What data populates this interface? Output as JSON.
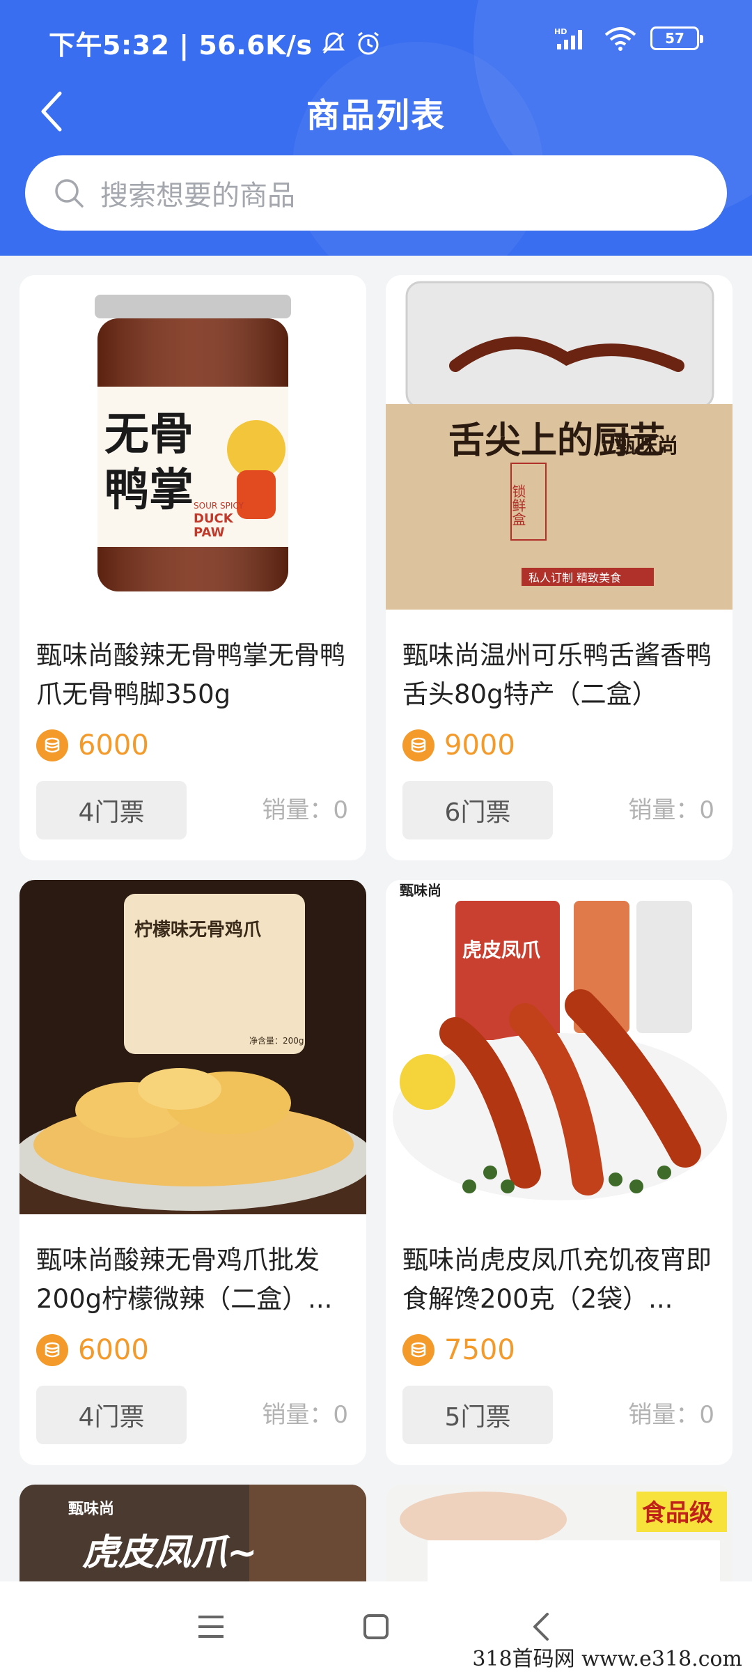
{
  "status_bar": {
    "time_speed": "下午5:32 | 56.6K/s",
    "network": "HD",
    "battery": "57"
  },
  "nav": {
    "title": "商品列表"
  },
  "search": {
    "placeholder": "搜索想要的商品"
  },
  "products": [
    {
      "name": "甄味尚酸辣无骨鸭掌无骨鸭爪无骨鸭脚350g",
      "price": "6000",
      "ticket": "4门票",
      "sales": "销量：0",
      "image_text": [
        "无骨",
        "鸭掌",
        "SOUR SPICY",
        "DUCK",
        "PAW"
      ]
    },
    {
      "name": "甄味尚温州可乐鸭舌酱香鸭舌头80g特产（二盒）",
      "price": "9000",
      "ticket": "6门票",
      "sales": "销量：0",
      "image_text": [
        "舌尖上的厨艺",
        "锁鲜盒",
        "甄味尚",
        "私人订制 精致美食"
      ]
    },
    {
      "name": "甄味尚酸辣无骨鸡爪批发200g柠檬微辣（二盒）...",
      "price": "6000",
      "ticket": "4门票",
      "sales": "销量：0",
      "image_text": [
        "柠檬味无骨鸡爪",
        "净含量：200g"
      ]
    },
    {
      "name": "甄味尚虎皮凤爪充饥夜宵即食解馋200克（2袋）...",
      "price": "7500",
      "ticket": "5门票",
      "sales": "销量：0",
      "image_text": [
        "甄味尚",
        "虎皮凤爪"
      ]
    }
  ],
  "partial_products": [
    {
      "image_text": [
        "甄味尚",
        "虎皮凤爪~"
      ]
    },
    {
      "image_text": [
        "食品级"
      ]
    }
  ],
  "watermark": "318首码网  www.e318.com",
  "colors": {
    "header_blue": "#3a6ef0",
    "price_orange": "#f39a2a"
  }
}
